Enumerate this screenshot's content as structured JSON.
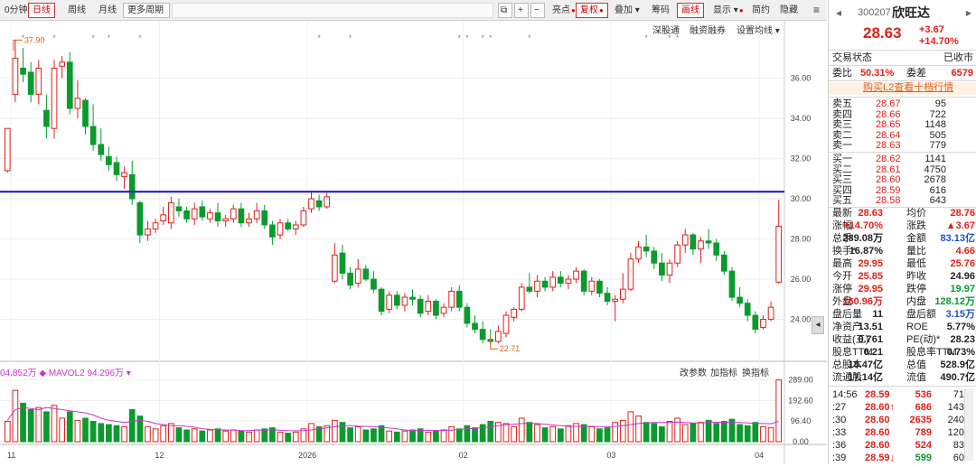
{
  "toolbar": {
    "items": [
      "0分钟",
      "日线",
      "周线",
      "月线",
      "更多周期"
    ],
    "active": "日线",
    "icons": [
      "copy-icon",
      "plus-icon",
      "minus-icon"
    ],
    "right_items": [
      "亮点",
      "复权",
      "叠加",
      "筹码",
      "画线",
      "显示",
      "简约",
      "隐藏"
    ],
    "menu_icon": "menu-icon"
  },
  "chart": {
    "sub_controls": [
      "深股通",
      "融资融券",
      "设置均线"
    ],
    "y_ticks": [
      "36.00",
      "34.00",
      "32.00",
      "30.00",
      "28.00",
      "26.00",
      "24.00"
    ],
    "price_min_label": "22.71",
    "price_max_label": "37.90",
    "vol_legend": "04.852万 ◆ MAVOL2 94.296万 ▾",
    "vol_controls": [
      "改参数",
      "加指标",
      "换指标"
    ],
    "vol_ticks": [
      "289.00",
      "192.60",
      "96.40",
      "0.00"
    ],
    "x_labels": [
      "11",
      "12",
      "2026",
      "02",
      "03",
      "04"
    ],
    "colors": {
      "up": "#e0201a",
      "down": "#0a9a2e",
      "line": "#1515c8",
      "ma": "#cc33cc"
    }
  },
  "chart_data": {
    "type": "candlestick",
    "price_range": [
      22.0,
      38.5
    ],
    "volume_range": [
      0,
      300
    ],
    "resistance_line": 30.35,
    "candles": [
      {
        "o": 31.4,
        "h": 32.6,
        "l": 31.3,
        "c": 33.5
      },
      {
        "o": 35.2,
        "h": 37.9,
        "l": 34.8,
        "c": 37.0
      },
      {
        "o": 36.5,
        "h": 37.5,
        "l": 35.8,
        "c": 36.2
      },
      {
        "o": 36.3,
        "h": 36.8,
        "l": 34.8,
        "c": 35.2
      },
      {
        "o": 35.2,
        "h": 36.9,
        "l": 34.7,
        "c": 36.5
      },
      {
        "o": 34.4,
        "h": 35.2,
        "l": 33.0,
        "c": 33.6
      },
      {
        "o": 33.5,
        "h": 36.9,
        "l": 33.0,
        "c": 36.5
      },
      {
        "o": 36.6,
        "h": 37.1,
        "l": 36.0,
        "c": 36.8
      },
      {
        "o": 36.8,
        "h": 37.3,
        "l": 34.2,
        "c": 34.5
      },
      {
        "o": 34.5,
        "h": 35.9,
        "l": 34.0,
        "c": 35.0
      },
      {
        "o": 34.9,
        "h": 35.0,
        "l": 33.2,
        "c": 33.6
      },
      {
        "o": 33.6,
        "h": 34.7,
        "l": 32.4,
        "c": 32.7
      },
      {
        "o": 32.7,
        "h": 33.5,
        "l": 31.9,
        "c": 32.2
      },
      {
        "o": 32.1,
        "h": 32.6,
        "l": 31.4,
        "c": 31.7
      },
      {
        "o": 31.8,
        "h": 32.1,
        "l": 30.9,
        "c": 31.2
      },
      {
        "o": 31.1,
        "h": 31.6,
        "l": 30.5,
        "c": 31.3
      },
      {
        "o": 31.2,
        "h": 31.9,
        "l": 29.7,
        "c": 30.0
      },
      {
        "o": 29.8,
        "h": 29.9,
        "l": 27.8,
        "c": 28.2
      },
      {
        "o": 28.2,
        "h": 28.9,
        "l": 27.9,
        "c": 28.5
      },
      {
        "o": 28.5,
        "h": 29.0,
        "l": 28.3,
        "c": 28.8
      },
      {
        "o": 28.9,
        "h": 29.6,
        "l": 28.7,
        "c": 29.2
      },
      {
        "o": 28.8,
        "h": 30.1,
        "l": 28.5,
        "c": 29.8
      },
      {
        "o": 29.6,
        "h": 30.0,
        "l": 29.1,
        "c": 29.4
      },
      {
        "o": 29.4,
        "h": 29.6,
        "l": 28.8,
        "c": 29.0
      },
      {
        "o": 29.0,
        "h": 29.8,
        "l": 28.7,
        "c": 29.5
      },
      {
        "o": 29.6,
        "h": 29.9,
        "l": 28.9,
        "c": 29.1
      },
      {
        "o": 29.0,
        "h": 29.5,
        "l": 28.8,
        "c": 29.3
      },
      {
        "o": 29.3,
        "h": 29.8,
        "l": 28.6,
        "c": 28.9
      },
      {
        "o": 28.9,
        "h": 29.2,
        "l": 28.6,
        "c": 29.0
      },
      {
        "o": 29.0,
        "h": 29.7,
        "l": 28.8,
        "c": 29.5
      },
      {
        "o": 29.5,
        "h": 29.8,
        "l": 28.6,
        "c": 28.8
      },
      {
        "o": 28.8,
        "h": 29.3,
        "l": 28.6,
        "c": 29.0
      },
      {
        "o": 29.0,
        "h": 29.8,
        "l": 28.8,
        "c": 29.4
      },
      {
        "o": 29.4,
        "h": 29.7,
        "l": 28.5,
        "c": 28.7
      },
      {
        "o": 28.7,
        "h": 28.9,
        "l": 27.7,
        "c": 28.1
      },
      {
        "o": 28.2,
        "h": 29.0,
        "l": 28.0,
        "c": 28.8
      },
      {
        "o": 28.8,
        "h": 29.0,
        "l": 28.4,
        "c": 28.5
      },
      {
        "o": 28.5,
        "h": 28.9,
        "l": 28.2,
        "c": 28.7
      },
      {
        "o": 28.7,
        "h": 29.6,
        "l": 28.6,
        "c": 29.4
      },
      {
        "o": 29.5,
        "h": 30.4,
        "l": 29.3,
        "c": 30.0
      },
      {
        "o": 29.9,
        "h": 30.2,
        "l": 29.4,
        "c": 29.6
      },
      {
        "o": 29.6,
        "h": 30.3,
        "l": 29.5,
        "c": 30.1
      },
      {
        "o": 25.9,
        "h": 27.8,
        "l": 25.8,
        "c": 27.2
      },
      {
        "o": 27.3,
        "h": 27.7,
        "l": 26.0,
        "c": 26.3
      },
      {
        "o": 26.3,
        "h": 26.6,
        "l": 25.5,
        "c": 25.7
      },
      {
        "o": 25.8,
        "h": 27.0,
        "l": 25.6,
        "c": 26.5
      },
      {
        "o": 26.5,
        "h": 26.7,
        "l": 25.9,
        "c": 26.0
      },
      {
        "o": 26.0,
        "h": 26.4,
        "l": 25.3,
        "c": 25.5
      },
      {
        "o": 25.5,
        "h": 25.6,
        "l": 24.2,
        "c": 24.4
      },
      {
        "o": 24.5,
        "h": 25.4,
        "l": 24.3,
        "c": 25.2
      },
      {
        "o": 25.2,
        "h": 25.4,
        "l": 24.5,
        "c": 24.7
      },
      {
        "o": 24.7,
        "h": 25.3,
        "l": 24.4,
        "c": 25.1
      },
      {
        "o": 25.1,
        "h": 25.5,
        "l": 24.7,
        "c": 25.0
      },
      {
        "o": 25.0,
        "h": 25.2,
        "l": 24.1,
        "c": 24.3
      },
      {
        "o": 24.4,
        "h": 25.2,
        "l": 24.2,
        "c": 24.9
      },
      {
        "o": 24.9,
        "h": 25.0,
        "l": 24.0,
        "c": 24.2
      },
      {
        "o": 24.3,
        "h": 24.8,
        "l": 24.1,
        "c": 24.6
      },
      {
        "o": 24.6,
        "h": 25.6,
        "l": 24.4,
        "c": 25.4
      },
      {
        "o": 25.4,
        "h": 25.7,
        "l": 24.4,
        "c": 24.6
      },
      {
        "o": 24.6,
        "h": 24.8,
        "l": 23.6,
        "c": 23.8
      },
      {
        "o": 23.8,
        "h": 24.2,
        "l": 23.3,
        "c": 23.5
      },
      {
        "o": 23.5,
        "h": 23.9,
        "l": 22.8,
        "c": 23.0
      },
      {
        "o": 23.0,
        "h": 23.5,
        "l": 22.71,
        "c": 22.9
      },
      {
        "o": 22.9,
        "h": 23.7,
        "l": 22.8,
        "c": 23.4
      },
      {
        "o": 23.3,
        "h": 24.4,
        "l": 23.1,
        "c": 24.2
      },
      {
        "o": 24.1,
        "h": 24.6,
        "l": 23.9,
        "c": 24.5
      },
      {
        "o": 24.5,
        "h": 25.8,
        "l": 24.4,
        "c": 25.6
      },
      {
        "o": 25.6,
        "h": 26.3,
        "l": 25.3,
        "c": 25.4
      },
      {
        "o": 25.4,
        "h": 26.2,
        "l": 25.1,
        "c": 25.9
      },
      {
        "o": 25.9,
        "h": 26.1,
        "l": 25.4,
        "c": 25.6
      },
      {
        "o": 25.6,
        "h": 26.4,
        "l": 25.4,
        "c": 26.1
      },
      {
        "o": 26.1,
        "h": 26.4,
        "l": 25.6,
        "c": 25.8
      },
      {
        "o": 25.8,
        "h": 26.2,
        "l": 25.5,
        "c": 26.0
      },
      {
        "o": 26.0,
        "h": 26.6,
        "l": 25.8,
        "c": 26.4
      },
      {
        "o": 26.4,
        "h": 26.5,
        "l": 25.2,
        "c": 25.4
      },
      {
        "o": 25.4,
        "h": 26.1,
        "l": 25.2,
        "c": 25.9
      },
      {
        "o": 25.9,
        "h": 26.0,
        "l": 25.1,
        "c": 25.3
      },
      {
        "o": 25.3,
        "h": 25.6,
        "l": 24.7,
        "c": 24.9
      },
      {
        "o": 24.9,
        "h": 25.2,
        "l": 23.9,
        "c": 25.0
      },
      {
        "o": 25.0,
        "h": 26.3,
        "l": 24.8,
        "c": 25.5
      },
      {
        "o": 25.5,
        "h": 27.3,
        "l": 25.4,
        "c": 27.0
      },
      {
        "o": 27.0,
        "h": 27.9,
        "l": 26.8,
        "c": 27.6
      },
      {
        "o": 27.6,
        "h": 28.2,
        "l": 27.1,
        "c": 27.4
      },
      {
        "o": 27.4,
        "h": 27.6,
        "l": 26.5,
        "c": 26.8
      },
      {
        "o": 26.8,
        "h": 27.3,
        "l": 25.9,
        "c": 26.2
      },
      {
        "o": 26.2,
        "h": 27.0,
        "l": 25.8,
        "c": 26.8
      },
      {
        "o": 26.8,
        "h": 27.9,
        "l": 26.6,
        "c": 27.7
      },
      {
        "o": 27.7,
        "h": 28.5,
        "l": 27.3,
        "c": 28.2
      },
      {
        "o": 28.2,
        "h": 28.3,
        "l": 27.2,
        "c": 27.5
      },
      {
        "o": 27.5,
        "h": 28.1,
        "l": 26.8,
        "c": 27.9
      },
      {
        "o": 27.9,
        "h": 28.5,
        "l": 27.5,
        "c": 27.8
      },
      {
        "o": 27.8,
        "h": 28.0,
        "l": 26.9,
        "c": 27.2
      },
      {
        "o": 27.2,
        "h": 27.4,
        "l": 26.2,
        "c": 26.4
      },
      {
        "o": 26.4,
        "h": 26.6,
        "l": 24.9,
        "c": 25.1
      },
      {
        "o": 25.1,
        "h": 25.6,
        "l": 24.6,
        "c": 24.8
      },
      {
        "o": 24.8,
        "h": 25.0,
        "l": 23.9,
        "c": 24.2
      },
      {
        "o": 24.2,
        "h": 24.4,
        "l": 23.3,
        "c": 23.5
      },
      {
        "o": 23.6,
        "h": 24.2,
        "l": 23.5,
        "c": 24.0
      },
      {
        "o": 24.0,
        "h": 24.9,
        "l": 23.9,
        "c": 24.6
      },
      {
        "o": 25.85,
        "h": 29.95,
        "l": 25.76,
        "c": 28.63
      }
    ],
    "volumes": [
      95,
      240,
      180,
      150,
      160,
      140,
      170,
      110,
      140,
      100,
      110,
      95,
      85,
      80,
      75,
      70,
      150,
      120,
      70,
      60,
      75,
      85,
      65,
      55,
      60,
      50,
      55,
      60,
      50,
      55,
      50,
      45,
      55,
      60,
      65,
      45,
      40,
      45,
      60,
      85,
      70,
      75,
      100,
      90,
      65,
      70,
      55,
      60,
      75,
      50,
      45,
      50,
      55,
      60,
      45,
      50,
      55,
      70,
      60,
      75,
      65,
      80,
      95,
      90,
      85,
      70,
      110,
      90,
      80,
      65,
      70,
      60,
      75,
      85,
      80,
      70,
      60,
      65,
      90,
      100,
      140,
      120,
      90,
      85,
      70,
      95,
      110,
      80,
      85,
      90,
      100,
      85,
      95,
      105,
      80,
      75,
      90,
      70,
      65,
      289
    ],
    "mavol": [
      100,
      150,
      160,
      155,
      150,
      160,
      155,
      150,
      145,
      140,
      135,
      125,
      110,
      100,
      95,
      90,
      95,
      100,
      95,
      85,
      80,
      75,
      75,
      72,
      68,
      60,
      58,
      55,
      55,
      54,
      52,
      52,
      54,
      55,
      55,
      54,
      52,
      51,
      52,
      55,
      60,
      65,
      70,
      75,
      75,
      73,
      72,
      70,
      68,
      64,
      60,
      55,
      52,
      52,
      54,
      53,
      52,
      54,
      57,
      60,
      63,
      65,
      70,
      75,
      80,
      82,
      85,
      86,
      85,
      82,
      78,
      75,
      72,
      72,
      72,
      72,
      70,
      70,
      72,
      75,
      80,
      85,
      88,
      90,
      90,
      90,
      92,
      90,
      88,
      88,
      90,
      91,
      90,
      90,
      90,
      88,
      86,
      85,
      84,
      95
    ]
  },
  "quote": {
    "code": "300207",
    "name": "欣旺达",
    "price": "28.63",
    "change": "+3.67",
    "change_pct": "+14.70%",
    "status_label": "交易状态",
    "status_value": "已收市",
    "weibi_label": "委比",
    "weibi_value": "50.31%",
    "weicha_label": "委差",
    "weicha_value": "6579",
    "l2_link": "购买L2查看十档行情",
    "asks": [
      {
        "label": "卖五",
        "price": "28.67",
        "vol": "95"
      },
      {
        "label": "卖四",
        "price": "28.66",
        "vol": "722"
      },
      {
        "label": "卖三",
        "price": "28.65",
        "vol": "1148"
      },
      {
        "label": "卖二",
        "price": "28.64",
        "vol": "505"
      },
      {
        "label": "卖一",
        "price": "28.63",
        "vol": "779"
      }
    ],
    "bids": [
      {
        "label": "买一",
        "price": "28.62",
        "vol": "1141"
      },
      {
        "label": "买二",
        "price": "28.61",
        "vol": "4750"
      },
      {
        "label": "买三",
        "price": "28.60",
        "vol": "2678"
      },
      {
        "label": "买四",
        "price": "28.59",
        "vol": "616"
      },
      {
        "label": "买五",
        "price": "28.58",
        "vol": "643"
      }
    ],
    "stats": [
      {
        "l1": "最新",
        "v1": "28.63",
        "c1": "red",
        "l2": "均价",
        "v2": "28.76",
        "c2": "red"
      },
      {
        "l1": "涨幅",
        "v1": "+14.70%",
        "c1": "red",
        "l2": "涨跌",
        "v2": "▲3.67",
        "c2": "red"
      },
      {
        "l1": "总手",
        "v1": "289.08万",
        "c1": "blk",
        "l2": "金额",
        "v2": "83.13亿",
        "c2": "blue"
      },
      {
        "l1": "换手*",
        "v1": "16.87%",
        "c1": "blk",
        "l2": "量比",
        "v2": "4.66",
        "c2": "red"
      },
      {
        "l1": "最高",
        "v1": "29.95",
        "c1": "red",
        "l2": "最低",
        "v2": "25.76",
        "c2": "red"
      },
      {
        "l1": "今开",
        "v1": "25.85",
        "c1": "red",
        "l2": "昨收",
        "v2": "24.96",
        "c2": "blk"
      },
      {
        "l1": "涨停",
        "v1": "29.95",
        "c1": "red",
        "l2": "跌停",
        "v2": "19.97",
        "c2": "green"
      },
      {
        "l1": "外盘",
        "v1": "160.96万",
        "c1": "red",
        "l2": "内盘",
        "v2": "128.12万",
        "c2": "green"
      },
      {
        "l1": "盘后量",
        "v1": "11",
        "c1": "blk",
        "l2": "盘后额",
        "v2": "3.15万",
        "c2": "blue"
      },
      {
        "l1": "净资产",
        "v1": "13.51",
        "c1": "blk",
        "l2": "ROE",
        "v2": "5.77%",
        "c2": "blk"
      },
      {
        "l1": "收益(三)",
        "v1": "0.761",
        "c1": "blk",
        "l2": "PE(动)*",
        "v2": "28.23",
        "c2": "blk"
      },
      {
        "l1": "股息TTM",
        "v1": "0.21",
        "c1": "blk",
        "l2": "股息率TTM",
        "v2": "0.73%",
        "c2": "blk"
      },
      {
        "l1": "总股本",
        "v1": "18.47亿",
        "c1": "blk",
        "l2": "总值",
        "v2": "528.9亿",
        "c2": "blk"
      },
      {
        "l1": "流通股",
        "v1": "17.14亿",
        "c1": "blk",
        "l2": "流值",
        "v2": "490.7亿",
        "c2": "blk"
      }
    ],
    "trades": [
      {
        "time": "14:56",
        "price": "28.59",
        "arrow": "",
        "vol": "536",
        "num": "71",
        "pc": "red",
        "vc": "red"
      },
      {
        "time": ":27",
        "price": "28.60",
        "arrow": "↑",
        "vol": "686",
        "num": "143",
        "pc": "red",
        "vc": "red"
      },
      {
        "time": ":30",
        "price": "28.60",
        "arrow": "",
        "vol": "2635",
        "num": "240",
        "pc": "red",
        "vc": "red"
      },
      {
        "time": ":33",
        "price": "28.60",
        "arrow": "",
        "vol": "789",
        "num": "120",
        "pc": "red",
        "vc": "red"
      },
      {
        "time": ":36",
        "price": "28.60",
        "arrow": "",
        "vol": "524",
        "num": "83",
        "pc": "red",
        "vc": "red"
      },
      {
        "time": ":39",
        "price": "28.59",
        "arrow": "↓",
        "vol": "599",
        "num": "60",
        "pc": "red",
        "vc": "green"
      }
    ]
  }
}
